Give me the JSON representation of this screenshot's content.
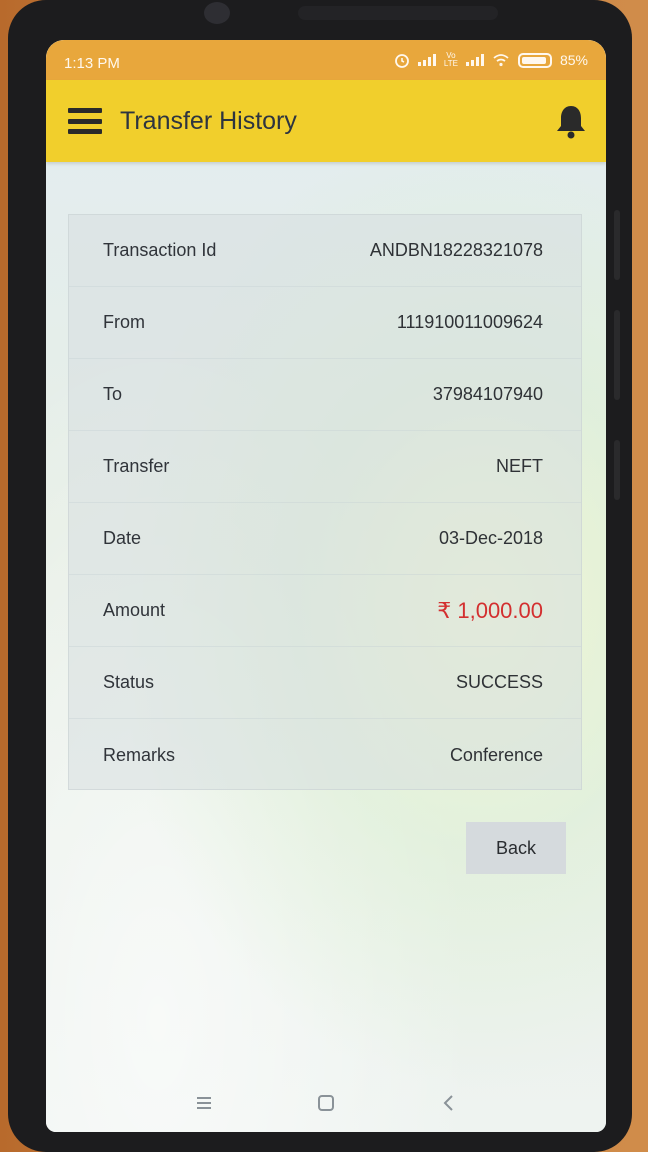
{
  "status_bar": {
    "time": "1:13 PM",
    "volte_top": "Vo",
    "volte_bottom": "LTE",
    "battery": "85%"
  },
  "app_bar": {
    "title": "Transfer History",
    "menu_icon": "hamburger-menu-icon",
    "bell_icon": "bell-icon"
  },
  "details": [
    {
      "label": "Transaction Id",
      "value": "ANDBN18228321078"
    },
    {
      "label": "From",
      "value": "111910011009624"
    },
    {
      "label": "To",
      "value": "37984107940"
    },
    {
      "label": "Transfer",
      "value": "NEFT"
    },
    {
      "label": "Date",
      "value": "03-Dec-2018"
    },
    {
      "label": "Amount",
      "value": "₹ 1,000.00"
    },
    {
      "label": "Status",
      "value": "SUCCESS"
    },
    {
      "label": "Remarks",
      "value": "Conference"
    }
  ],
  "back_button": "Back",
  "colors": {
    "status_bar": "#e8a73c",
    "app_bar": "#f1cf2c",
    "amount": "#d32f2f"
  }
}
